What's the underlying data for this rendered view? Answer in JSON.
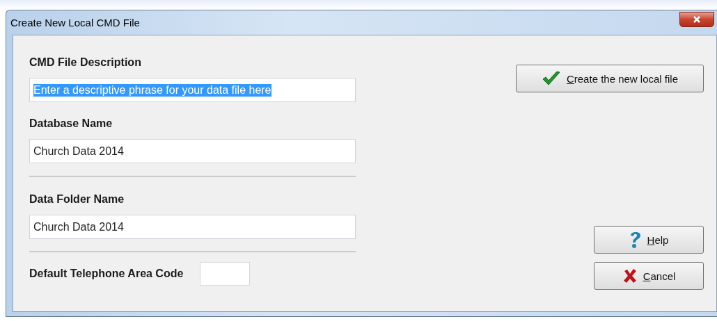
{
  "window": {
    "title": "Create New Local CMD File"
  },
  "fields": [
    {
      "label": "CMD File Description",
      "value": "Enter a descriptive phrase for your data file here",
      "text_selected": true
    },
    {
      "label": "Database Name",
      "value": "Church Data 2014",
      "text_selected": false
    },
    {
      "label": "Data Folder Name",
      "value": "Church Data 2014",
      "text_selected": false
    }
  ],
  "area_code": {
    "label": "Default Telephone Area Code"
  },
  "buttons": [
    {
      "kind": "check",
      "label": "Create the new local file"
    },
    {
      "kind": "help",
      "label": "Help"
    },
    {
      "kind": "cancel",
      "label": "Cancel"
    }
  ]
}
